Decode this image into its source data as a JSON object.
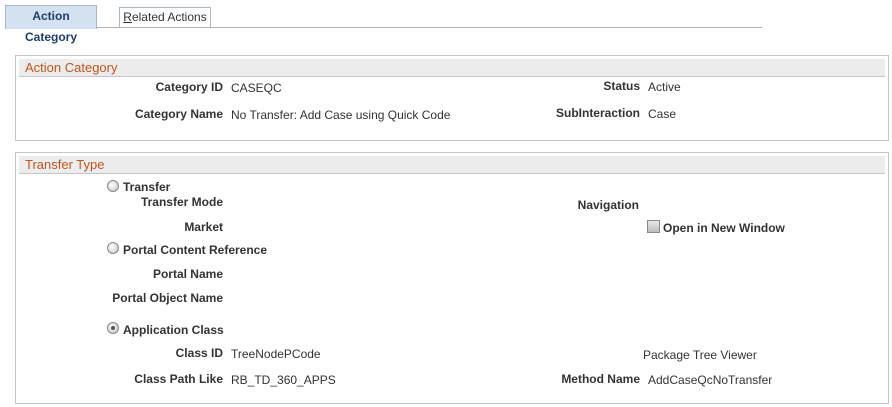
{
  "tabs": [
    {
      "label": "Action Category",
      "active": true
    },
    {
      "label_underlined": "R",
      "label_rest": "elated Actions",
      "active": false
    }
  ],
  "action_category": {
    "header": "Action Category",
    "category_id_label": "Category ID",
    "category_id_value": "CASEQC",
    "status_label": "Status",
    "status_value": "Active",
    "category_name_label": "Category Name",
    "category_name_value": "No Transfer: Add Case using Quick Code",
    "subinteraction_label": "SubInteraction",
    "subinteraction_value": "Case"
  },
  "transfer_type": {
    "header": "Transfer Type",
    "transfer_radio_label": "Transfer",
    "transfer_mode_label": "Transfer Mode",
    "navigation_label": "Navigation",
    "market_label": "Market",
    "open_new_window_label": "Open in New Window",
    "portal_content_ref_label": "Portal Content Reference",
    "portal_name_label": "Portal Name",
    "portal_object_name_label": "Portal Object Name",
    "application_class_label": "Application Class",
    "class_id_label": "Class ID",
    "class_id_value": "TreeNodePCode",
    "package_value": "Package Tree Viewer",
    "class_path_label": "Class Path Like",
    "class_path_value": "RB_TD_360_APPS",
    "method_name_label": "Method Name",
    "method_name_value": "AddCaseQcNoTransfer",
    "selected_transfer_type": "Application Class"
  },
  "colors": {
    "accent": "#c1561d",
    "tab_active_bg": "#d4e1f0",
    "header_bg": "#ececec"
  }
}
